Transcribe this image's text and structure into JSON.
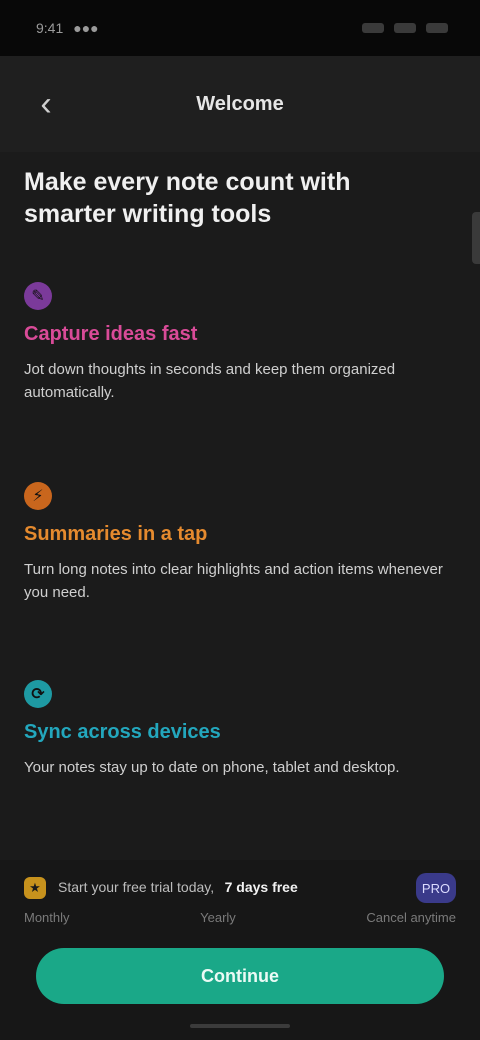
{
  "status_bar": {
    "time": "9:41",
    "carrier": "●●●",
    "icons": [
      "signal-icon",
      "wifi-icon",
      "battery-icon"
    ]
  },
  "header": {
    "title": "Welcome",
    "back_icon": "chevron-left-icon"
  },
  "headline": "Make every note count with smarter writing tools",
  "features": [
    {
      "icon": "pen-icon",
      "icon_glyph": "✎",
      "title": "Capture ideas fast",
      "description": "Jot down thoughts in seconds and keep them organized automatically."
    },
    {
      "icon": "lightning-icon",
      "icon_glyph": "⚡",
      "title": "Summaries in a tap",
      "description": "Turn long notes into clear highlights and action items whenever you need."
    },
    {
      "icon": "sync-icon",
      "icon_glyph": "⟳",
      "title": "Sync across devices",
      "description": "Your notes stay up to date on phone, tablet and desktop."
    }
  ],
  "plan": {
    "badge_glyph": "★",
    "text": "Start your free trial today,",
    "highlight": "7 days free",
    "avatar": "PRO",
    "meta_left": "Monthly",
    "meta_center": "Yearly",
    "meta_right": "Cancel anytime"
  },
  "cta": {
    "label": "Continue"
  },
  "colors": {
    "background": "#1b1b1b",
    "accent_cta": "#1aa888",
    "feature_1": "#d94b98",
    "feature_2": "#e58a2e",
    "feature_3": "#23a7bd"
  }
}
